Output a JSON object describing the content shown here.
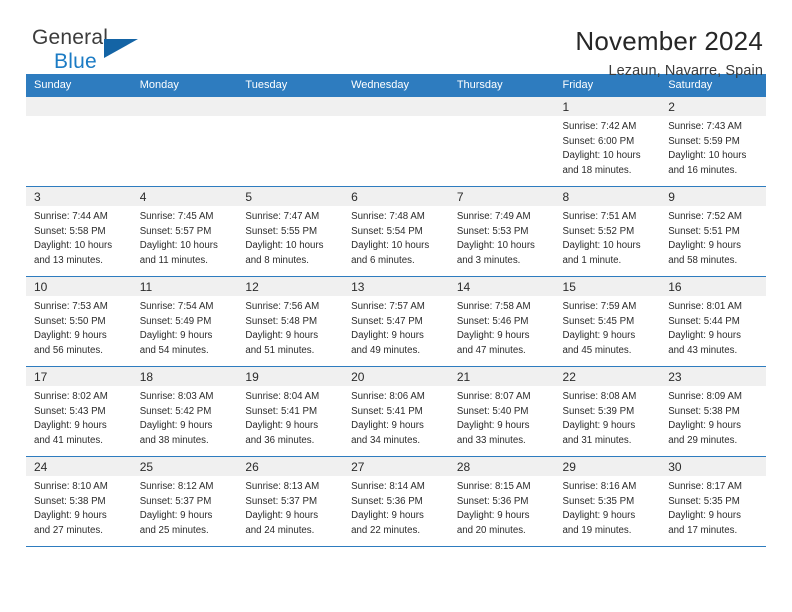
{
  "brand": {
    "name_part1": "General",
    "name_part2": "Blue",
    "logo_icon": "triangle-flag-icon"
  },
  "header": {
    "title": "November 2024",
    "subtitle": "Lezaun, Navarre, Spain"
  },
  "calendar": {
    "weekday_headers": [
      "Sunday",
      "Monday",
      "Tuesday",
      "Wednesday",
      "Thursday",
      "Friday",
      "Saturday"
    ],
    "accent_color": "#2e7cbf",
    "daynum_background": "#f0f0f0",
    "weeks": [
      [
        {
          "day": "",
          "empty": true
        },
        {
          "day": "",
          "empty": true
        },
        {
          "day": "",
          "empty": true
        },
        {
          "day": "",
          "empty": true
        },
        {
          "day": "",
          "empty": true
        },
        {
          "day": "1",
          "sunrise": "Sunrise: 7:42 AM",
          "sunset": "Sunset: 6:00 PM",
          "daylight_line1": "Daylight: 10 hours",
          "daylight_line2": "and 18 minutes."
        },
        {
          "day": "2",
          "sunrise": "Sunrise: 7:43 AM",
          "sunset": "Sunset: 5:59 PM",
          "daylight_line1": "Daylight: 10 hours",
          "daylight_line2": "and 16 minutes."
        }
      ],
      [
        {
          "day": "3",
          "sunrise": "Sunrise: 7:44 AM",
          "sunset": "Sunset: 5:58 PM",
          "daylight_line1": "Daylight: 10 hours",
          "daylight_line2": "and 13 minutes."
        },
        {
          "day": "4",
          "sunrise": "Sunrise: 7:45 AM",
          "sunset": "Sunset: 5:57 PM",
          "daylight_line1": "Daylight: 10 hours",
          "daylight_line2": "and 11 minutes."
        },
        {
          "day": "5",
          "sunrise": "Sunrise: 7:47 AM",
          "sunset": "Sunset: 5:55 PM",
          "daylight_line1": "Daylight: 10 hours",
          "daylight_line2": "and 8 minutes."
        },
        {
          "day": "6",
          "sunrise": "Sunrise: 7:48 AM",
          "sunset": "Sunset: 5:54 PM",
          "daylight_line1": "Daylight: 10 hours",
          "daylight_line2": "and 6 minutes."
        },
        {
          "day": "7",
          "sunrise": "Sunrise: 7:49 AM",
          "sunset": "Sunset: 5:53 PM",
          "daylight_line1": "Daylight: 10 hours",
          "daylight_line2": "and 3 minutes."
        },
        {
          "day": "8",
          "sunrise": "Sunrise: 7:51 AM",
          "sunset": "Sunset: 5:52 PM",
          "daylight_line1": "Daylight: 10 hours",
          "daylight_line2": "and 1 minute."
        },
        {
          "day": "9",
          "sunrise": "Sunrise: 7:52 AM",
          "sunset": "Sunset: 5:51 PM",
          "daylight_line1": "Daylight: 9 hours",
          "daylight_line2": "and 58 minutes."
        }
      ],
      [
        {
          "day": "10",
          "sunrise": "Sunrise: 7:53 AM",
          "sunset": "Sunset: 5:50 PM",
          "daylight_line1": "Daylight: 9 hours",
          "daylight_line2": "and 56 minutes."
        },
        {
          "day": "11",
          "sunrise": "Sunrise: 7:54 AM",
          "sunset": "Sunset: 5:49 PM",
          "daylight_line1": "Daylight: 9 hours",
          "daylight_line2": "and 54 minutes."
        },
        {
          "day": "12",
          "sunrise": "Sunrise: 7:56 AM",
          "sunset": "Sunset: 5:48 PM",
          "daylight_line1": "Daylight: 9 hours",
          "daylight_line2": "and 51 minutes."
        },
        {
          "day": "13",
          "sunrise": "Sunrise: 7:57 AM",
          "sunset": "Sunset: 5:47 PM",
          "daylight_line1": "Daylight: 9 hours",
          "daylight_line2": "and 49 minutes."
        },
        {
          "day": "14",
          "sunrise": "Sunrise: 7:58 AM",
          "sunset": "Sunset: 5:46 PM",
          "daylight_line1": "Daylight: 9 hours",
          "daylight_line2": "and 47 minutes."
        },
        {
          "day": "15",
          "sunrise": "Sunrise: 7:59 AM",
          "sunset": "Sunset: 5:45 PM",
          "daylight_line1": "Daylight: 9 hours",
          "daylight_line2": "and 45 minutes."
        },
        {
          "day": "16",
          "sunrise": "Sunrise: 8:01 AM",
          "sunset": "Sunset: 5:44 PM",
          "daylight_line1": "Daylight: 9 hours",
          "daylight_line2": "and 43 minutes."
        }
      ],
      [
        {
          "day": "17",
          "sunrise": "Sunrise: 8:02 AM",
          "sunset": "Sunset: 5:43 PM",
          "daylight_line1": "Daylight: 9 hours",
          "daylight_line2": "and 41 minutes."
        },
        {
          "day": "18",
          "sunrise": "Sunrise: 8:03 AM",
          "sunset": "Sunset: 5:42 PM",
          "daylight_line1": "Daylight: 9 hours",
          "daylight_line2": "and 38 minutes."
        },
        {
          "day": "19",
          "sunrise": "Sunrise: 8:04 AM",
          "sunset": "Sunset: 5:41 PM",
          "daylight_line1": "Daylight: 9 hours",
          "daylight_line2": "and 36 minutes."
        },
        {
          "day": "20",
          "sunrise": "Sunrise: 8:06 AM",
          "sunset": "Sunset: 5:41 PM",
          "daylight_line1": "Daylight: 9 hours",
          "daylight_line2": "and 34 minutes."
        },
        {
          "day": "21",
          "sunrise": "Sunrise: 8:07 AM",
          "sunset": "Sunset: 5:40 PM",
          "daylight_line1": "Daylight: 9 hours",
          "daylight_line2": "and 33 minutes."
        },
        {
          "day": "22",
          "sunrise": "Sunrise: 8:08 AM",
          "sunset": "Sunset: 5:39 PM",
          "daylight_line1": "Daylight: 9 hours",
          "daylight_line2": "and 31 minutes."
        },
        {
          "day": "23",
          "sunrise": "Sunrise: 8:09 AM",
          "sunset": "Sunset: 5:38 PM",
          "daylight_line1": "Daylight: 9 hours",
          "daylight_line2": "and 29 minutes."
        }
      ],
      [
        {
          "day": "24",
          "sunrise": "Sunrise: 8:10 AM",
          "sunset": "Sunset: 5:38 PM",
          "daylight_line1": "Daylight: 9 hours",
          "daylight_line2": "and 27 minutes."
        },
        {
          "day": "25",
          "sunrise": "Sunrise: 8:12 AM",
          "sunset": "Sunset: 5:37 PM",
          "daylight_line1": "Daylight: 9 hours",
          "daylight_line2": "and 25 minutes."
        },
        {
          "day": "26",
          "sunrise": "Sunrise: 8:13 AM",
          "sunset": "Sunset: 5:37 PM",
          "daylight_line1": "Daylight: 9 hours",
          "daylight_line2": "and 24 minutes."
        },
        {
          "day": "27",
          "sunrise": "Sunrise: 8:14 AM",
          "sunset": "Sunset: 5:36 PM",
          "daylight_line1": "Daylight: 9 hours",
          "daylight_line2": "and 22 minutes."
        },
        {
          "day": "28",
          "sunrise": "Sunrise: 8:15 AM",
          "sunset": "Sunset: 5:36 PM",
          "daylight_line1": "Daylight: 9 hours",
          "daylight_line2": "and 20 minutes."
        },
        {
          "day": "29",
          "sunrise": "Sunrise: 8:16 AM",
          "sunset": "Sunset: 5:35 PM",
          "daylight_line1": "Daylight: 9 hours",
          "daylight_line2": "and 19 minutes."
        },
        {
          "day": "30",
          "sunrise": "Sunrise: 8:17 AM",
          "sunset": "Sunset: 5:35 PM",
          "daylight_line1": "Daylight: 9 hours",
          "daylight_line2": "and 17 minutes."
        }
      ]
    ]
  }
}
